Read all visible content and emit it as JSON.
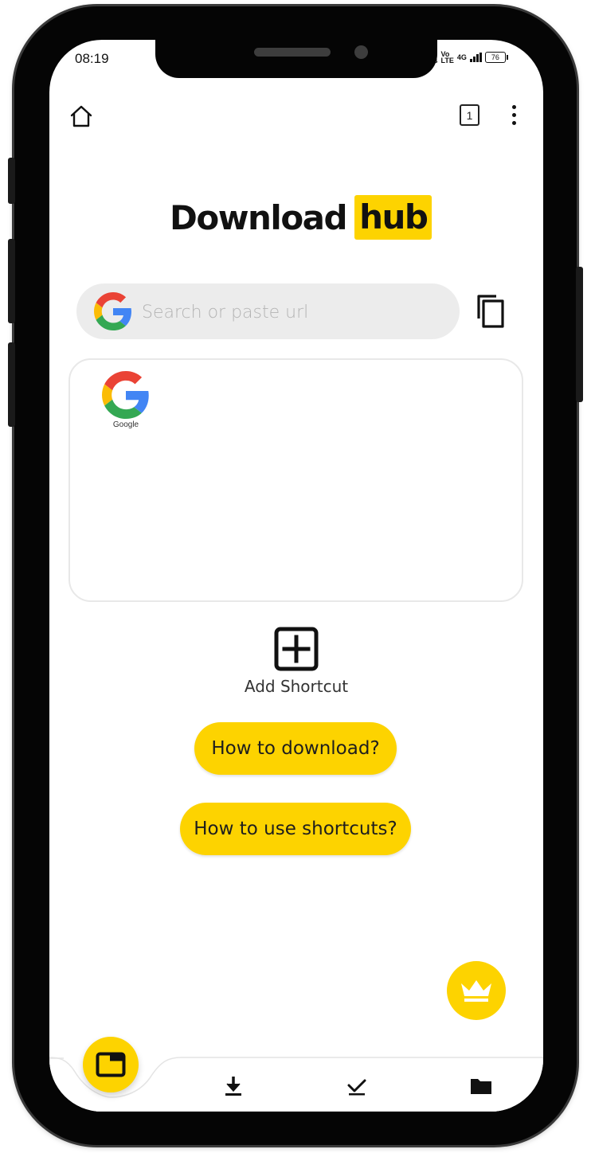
{
  "status_bar": {
    "time": "08:19",
    "net_speed": "0",
    "net_unit": "/s",
    "volte": "Vo",
    "lte": "LTE",
    "network": "4G",
    "battery": "76"
  },
  "top_bar": {
    "tab_count": "1"
  },
  "logo": {
    "text": "Download",
    "highlight": "hub"
  },
  "search": {
    "placeholder": "Search or paste url"
  },
  "shortcuts": [
    {
      "label": "Google",
      "icon": "google-icon"
    }
  ],
  "add_shortcut": {
    "label": "Add Shortcut"
  },
  "help_buttons": {
    "download": "How to download?",
    "shortcuts": "How to use shortcuts?"
  },
  "icons": {
    "home": "home-icon",
    "paste": "paste-icon",
    "premium": "crown-icon",
    "browser": "browser-window-icon",
    "downloads": "download-icon",
    "completed": "check-icon",
    "files": "folder-icon"
  },
  "colors": {
    "accent": "#fdd300",
    "search_bg": "#ececec",
    "text": "#111111"
  }
}
